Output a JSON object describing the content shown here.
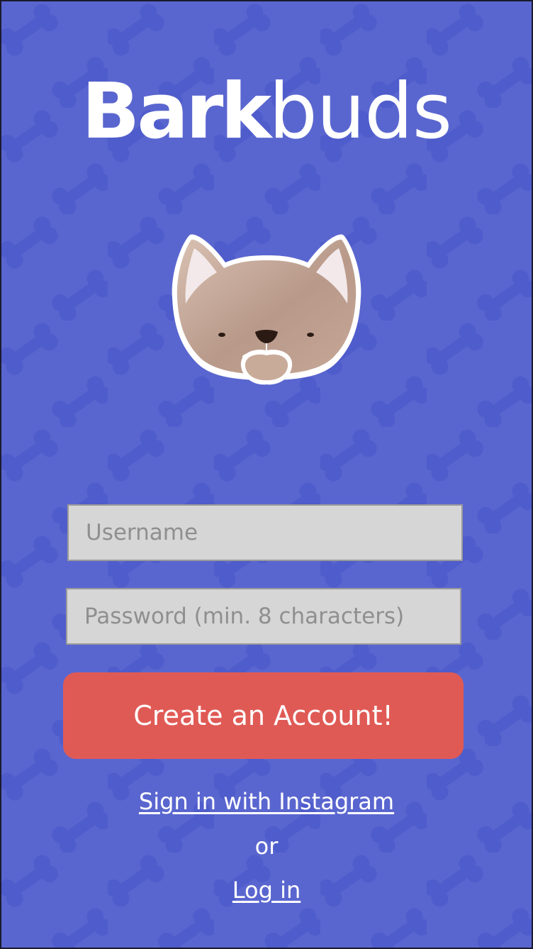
{
  "app": {
    "logo_bold": "Bark",
    "logo_light": "buds"
  },
  "form": {
    "username_placeholder": "Username",
    "password_placeholder": "Password (min. 8 characters)",
    "create_account_label": "Create an Account!"
  },
  "links": {
    "instagram_label": "Sign in with Instagram",
    "or_text": "or",
    "login_label": "Log in"
  },
  "colors": {
    "background": "#5a66cf",
    "pattern": "#4f5ccb",
    "cta": "#e05a55",
    "field": "#d6d6d6",
    "dog_fur": "#bf9f8c",
    "dog_ear_inner": "#f3e9ea"
  },
  "icons": {
    "mascot": "dog-face-icon",
    "background": "bone-pattern"
  }
}
